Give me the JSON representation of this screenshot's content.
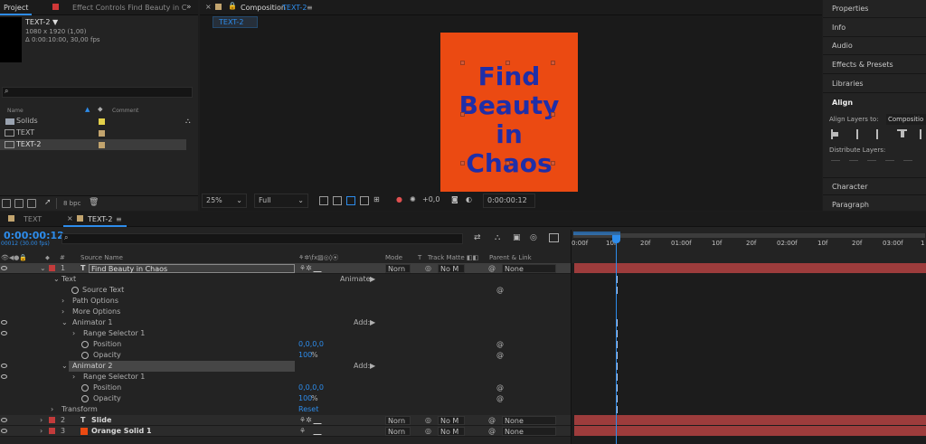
{
  "project": {
    "tab_project": "Project",
    "tab_effect": "Effect Controls Find Beauty in C",
    "item_name": "TEXT-2 ▼",
    "item_dims": "1080 x 1920 (1,00)",
    "item_duration": "Δ 0:00:10:00, 30,00 fps",
    "col_name": "Name",
    "col_comment": "Comment",
    "items": [
      {
        "label": "Solids",
        "color": "#e3d04a"
      },
      {
        "label": "TEXT",
        "color": "#c2a46e"
      },
      {
        "label": "TEXT-2",
        "color": "#c2a46e"
      }
    ],
    "bpc": "8 bpc"
  },
  "composition": {
    "tab_label": "Composition",
    "tab_name": "TEXT-2",
    "breadcrumb": "TEXT-2",
    "artboard_lines": [
      "Find",
      "Beauty",
      "in",
      "Chaos"
    ],
    "zoom": "25%",
    "resolution": "Full",
    "exposure": "+0,0",
    "timecode": "0:00:00:12"
  },
  "right_panel": {
    "items": [
      "Properties",
      "Info",
      "Audio",
      "Effects & Presets",
      "Libraries",
      "Align"
    ],
    "align_layers_to": "Align Layers to:",
    "align_target": "Compositio",
    "distribute": "Distribute Layers:",
    "character": "Character",
    "paragraph": "Paragraph"
  },
  "timeline": {
    "tab_text": "TEXT",
    "tab_text2": "TEXT-2",
    "timecode": "0:00:00:12",
    "frame_info": "00012 (30.00 fps)",
    "col_source_name": "Source Name",
    "col_mode": "Mode",
    "col_t": "T",
    "col_track_matte": "Track Matte",
    "col_parent": "Parent & Link",
    "ruler": [
      "0:00f",
      "10f",
      "20f",
      "01:00f",
      "10f",
      "20f",
      "02:00f",
      "10f",
      "20f",
      "03:00f",
      "1"
    ],
    "layers": [
      {
        "num": "1",
        "name": "Find Beauty in Chaos",
        "mode": "Norn",
        "matte": "No M",
        "parent": "None",
        "color": "#c23b3b"
      },
      {
        "num": "2",
        "name": "Slide",
        "mode": "Norn",
        "matte": "No M",
        "parent": "None",
        "color": "#c23b3b"
      },
      {
        "num": "3",
        "name": "Orange Solid 1",
        "mode": "Norn",
        "matte": "No M",
        "parent": "None",
        "color": "#c23b3b"
      }
    ],
    "props": {
      "text": "Text",
      "animate": "Animate:",
      "source_text": "Source Text",
      "path_options": "Path Options",
      "more_options": "More Options",
      "animator1": "Animator 1",
      "add1": "Add:",
      "range_selector1": "Range Selector 1",
      "position1": "Position",
      "position1_val": "0,0,0,0",
      "opacity1": "Opacity",
      "opacity1_val": "100",
      "animator2": "Animator 2",
      "add2": "Add:",
      "range_selector2": "Range Selector 1",
      "position2": "Position",
      "position2_val": "0,0,0,0",
      "opacity2": "Opacity",
      "opacity2_val": "100",
      "percent": "%",
      "transform": "Transform",
      "reset": "Reset"
    }
  }
}
